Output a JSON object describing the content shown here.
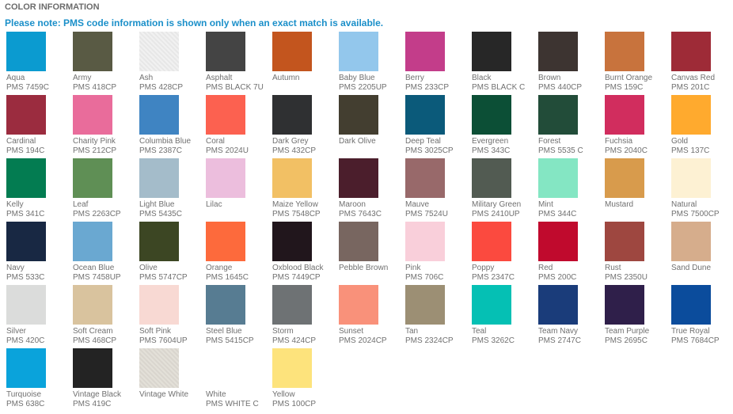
{
  "header": "COLOR INFORMATION",
  "note": "Please note: PMS code information is shown only when an exact match is available.",
  "colors": [
    {
      "name": "Aqua",
      "pms": "PMS 7459C",
      "hex": "#0b9bd0"
    },
    {
      "name": "Army",
      "pms": "PMS 418CP",
      "hex": "#595a44"
    },
    {
      "name": "Ash",
      "pms": "PMS 428CP",
      "hex": "#f0f0f0",
      "textured": true
    },
    {
      "name": "Asphalt",
      "pms": "PMS BLACK 7U",
      "hex": "#444444"
    },
    {
      "name": "Autumn",
      "pms": "",
      "hex": "#c3551e"
    },
    {
      "name": "Baby Blue",
      "pms": "PMS 2205UP",
      "hex": "#93c7ec"
    },
    {
      "name": "Berry",
      "pms": "PMS 233CP",
      "hex": "#c33d8a"
    },
    {
      "name": "Black",
      "pms": "PMS BLACK C",
      "hex": "#272727"
    },
    {
      "name": "Brown",
      "pms": "PMS 440CP",
      "hex": "#3d3431"
    },
    {
      "name": "Burnt Orange",
      "pms": "PMS 159C",
      "hex": "#c8733d"
    },
    {
      "name": "Canvas Red",
      "pms": "PMS 201C",
      "hex": "#9e2b37"
    },
    {
      "name": "Cardinal",
      "pms": "PMS 194C",
      "hex": "#9b2c3f"
    },
    {
      "name": "Charity Pink",
      "pms": "PMS 212CP",
      "hex": "#e96c9b"
    },
    {
      "name": "Columbia Blue",
      "pms": "PMS 2387C",
      "hex": "#3f84c2"
    },
    {
      "name": "Coral",
      "pms": "PMS 2024U",
      "hex": "#fc6150"
    },
    {
      "name": "Dark Grey",
      "pms": "PMS 432CP",
      "hex": "#2f3032"
    },
    {
      "name": "Dark Olive",
      "pms": "",
      "hex": "#433e30"
    },
    {
      "name": "Deep Teal",
      "pms": "PMS 3025CP",
      "hex": "#0b5a7a"
    },
    {
      "name": "Evergreen",
      "pms": "PMS 343C",
      "hex": "#0c4f36"
    },
    {
      "name": "Forest",
      "pms": "PMS 5535 C",
      "hex": "#224c39"
    },
    {
      "name": "Fuchsia",
      "pms": "PMS 2040C",
      "hex": "#d12d5e"
    },
    {
      "name": "Gold",
      "pms": "PMS 137C",
      "hex": "#ffaa2e"
    },
    {
      "name": "Kelly",
      "pms": "PMS 341C",
      "hex": "#037c51"
    },
    {
      "name": "Leaf",
      "pms": "PMS 2263CP",
      "hex": "#5f8f55"
    },
    {
      "name": "Light Blue",
      "pms": "PMS 5435C",
      "hex": "#a4bcca"
    },
    {
      "name": "Lilac",
      "pms": "",
      "hex": "#ecbedd"
    },
    {
      "name": "Maize Yellow",
      "pms": "PMS 7548CP",
      "hex": "#f2c064"
    },
    {
      "name": "Maroon",
      "pms": "PMS 7643C",
      "hex": "#4b1e2c"
    },
    {
      "name": "Mauve",
      "pms": "PMS 7524U",
      "hex": "#98696a"
    },
    {
      "name": "Military Green",
      "pms": "PMS 2410UP",
      "hex": "#525b52"
    },
    {
      "name": "Mint",
      "pms": "PMS 344C",
      "hex": "#84e6c3"
    },
    {
      "name": "Mustard",
      "pms": "",
      "hex": "#d89b4c"
    },
    {
      "name": "Natural",
      "pms": "PMS 7500CP",
      "hex": "#fdf1d3"
    },
    {
      "name": "Navy",
      "pms": "PMS 533C",
      "hex": "#182843"
    },
    {
      "name": "Ocean Blue",
      "pms": "PMS 7458UP",
      "hex": "#6aa8d1"
    },
    {
      "name": "Olive",
      "pms": "PMS 5747CP",
      "hex": "#3c4623"
    },
    {
      "name": "Orange",
      "pms": "PMS 1645C",
      "hex": "#fd6a3c"
    },
    {
      "name": "Oxblood Black",
      "pms": "PMS 7449CP",
      "hex": "#21161c"
    },
    {
      "name": "Pebble Brown",
      "pms": "",
      "hex": "#786660"
    },
    {
      "name": "Pink",
      "pms": "PMS 706C",
      "hex": "#f9cfda"
    },
    {
      "name": "Poppy",
      "pms": "PMS 2347C",
      "hex": "#fb4a3f"
    },
    {
      "name": "Red",
      "pms": "PMS 200C",
      "hex": "#c00a2d"
    },
    {
      "name": "Rust",
      "pms": "PMS 2350U",
      "hex": "#9e4740"
    },
    {
      "name": "Sand Dune",
      "pms": "",
      "hex": "#d6ad8c"
    },
    {
      "name": "Silver",
      "pms": "PMS 420C",
      "hex": "#dbdcdb"
    },
    {
      "name": "Soft Cream",
      "pms": "PMS 468CP",
      "hex": "#d9c39e"
    },
    {
      "name": "Soft Pink",
      "pms": "PMS 7604UP",
      "hex": "#f8d9d3"
    },
    {
      "name": "Steel Blue",
      "pms": "PMS 5415CP",
      "hex": "#577c92"
    },
    {
      "name": "Storm",
      "pms": "PMS 424CP",
      "hex": "#6e7274"
    },
    {
      "name": "Sunset",
      "pms": "PMS 2024CP",
      "hex": "#f9917a"
    },
    {
      "name": "Tan",
      "pms": "PMS 2324CP",
      "hex": "#9c8f74"
    },
    {
      "name": "Teal",
      "pms": "PMS 3262C",
      "hex": "#05c0b4"
    },
    {
      "name": "Team Navy",
      "pms": "PMS 2747C",
      "hex": "#1a3c7a"
    },
    {
      "name": "Team Purple",
      "pms": "PMS 2695C",
      "hex": "#2f1f4a"
    },
    {
      "name": "True Royal",
      "pms": "PMS 7684CP",
      "hex": "#0b4c9c"
    },
    {
      "name": "Turquoise",
      "pms": "PMS 638C",
      "hex": "#0aa3db"
    },
    {
      "name": "Vintage Black",
      "pms": "PMS 419C",
      "hex": "#232323"
    },
    {
      "name": "Vintage White",
      "pms": "",
      "hex": "#e2ded6",
      "textured": true
    },
    {
      "name": "White",
      "pms": "PMS WHITE C",
      "hex": "#ffffff"
    },
    {
      "name": "Yellow",
      "pms": "PMS 100CP",
      "hex": "#fde37c"
    }
  ]
}
